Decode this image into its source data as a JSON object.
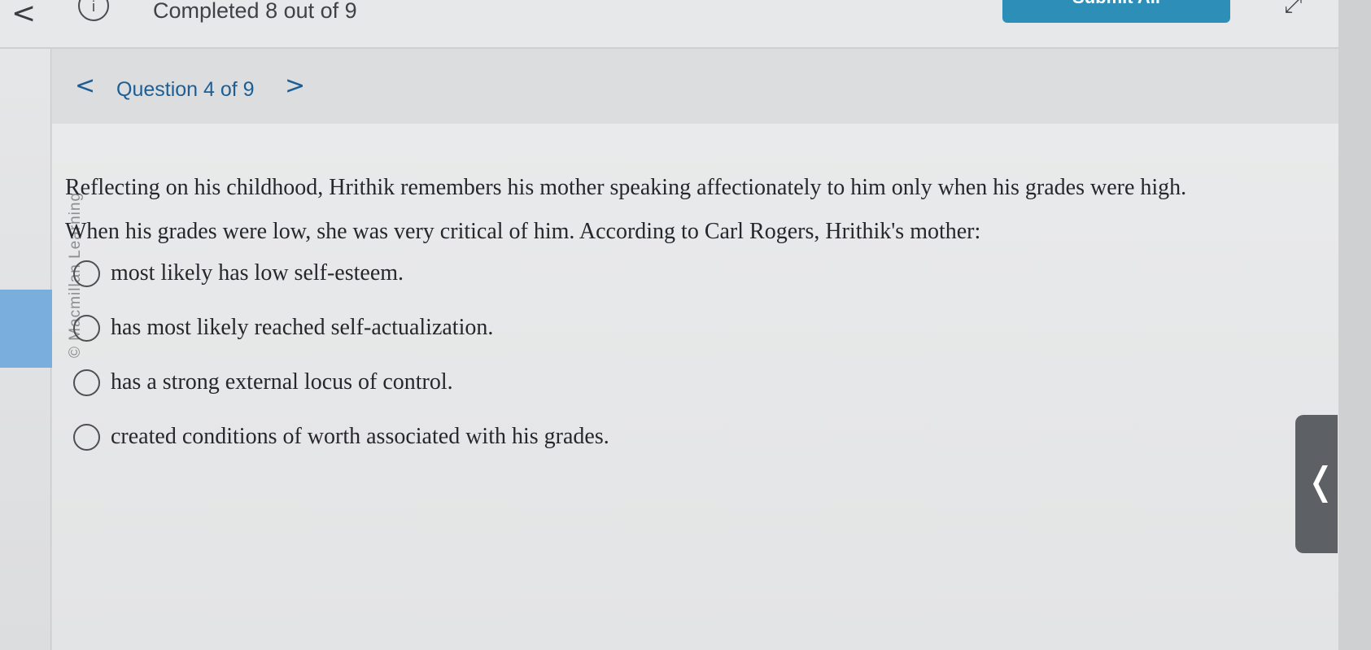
{
  "header": {
    "back_label": "<",
    "info_label": "i",
    "completed": "Completed 8 out of 9",
    "submit_label": "Submit All",
    "expand_label": "⤢"
  },
  "nav": {
    "prev_label": "<",
    "counter": "Question 4 of 9",
    "next_label": ">"
  },
  "watermark": "© Macmillan Learning",
  "question": {
    "line1": "Reflecting on his childhood, Hrithik remembers his mother speaking affectionately to him only when his grades were high.",
    "line2": "When his grades were low, she was very critical of him. According to Carl Rogers, Hrithik's mother:",
    "options": [
      "most likely has low self-esteem.",
      "has most likely reached self-actualization.",
      "has a strong external locus of control.",
      "created conditions of worth associated with his grades."
    ],
    "selected": null
  },
  "drawer": {
    "toggle_label": "❬"
  },
  "colors": {
    "accent": "#1d5f94",
    "submit": "#2d8fb8",
    "rail_accent": "#7aaedc"
  }
}
